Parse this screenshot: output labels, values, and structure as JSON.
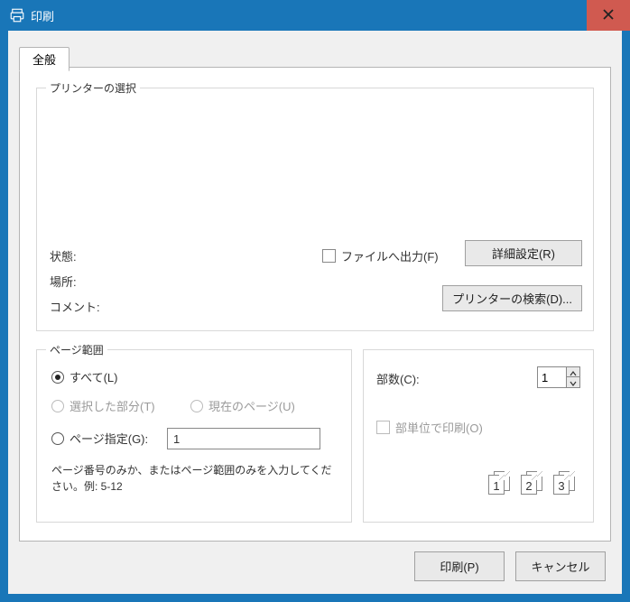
{
  "window": {
    "title": "印刷"
  },
  "tab": {
    "general": "全般"
  },
  "printerSel": {
    "legend": "プリンターの選択",
    "status_label": "状態:",
    "location_label": "場所:",
    "comment_label": "コメント:",
    "print_to_file": "ファイルへ出力(F)",
    "details_btn": "詳細設定(R)",
    "find_printer_btn": "プリンターの検索(D)..."
  },
  "pageRange": {
    "legend": "ページ範囲",
    "all": "すべて(L)",
    "selection": "選択した部分(T)",
    "current": "現在のページ(U)",
    "specify": "ページ指定(G):",
    "specify_value": "1",
    "hint": "ページ番号のみか、またはページ範囲のみを入力してください。例: 5-12"
  },
  "copies": {
    "count_label": "部数(C):",
    "count_value": "1",
    "collate": "部単位で印刷(O)",
    "p1": "1",
    "p2": "2",
    "p3": "3"
  },
  "buttons": {
    "print": "印刷(P)",
    "cancel": "キャンセル"
  }
}
